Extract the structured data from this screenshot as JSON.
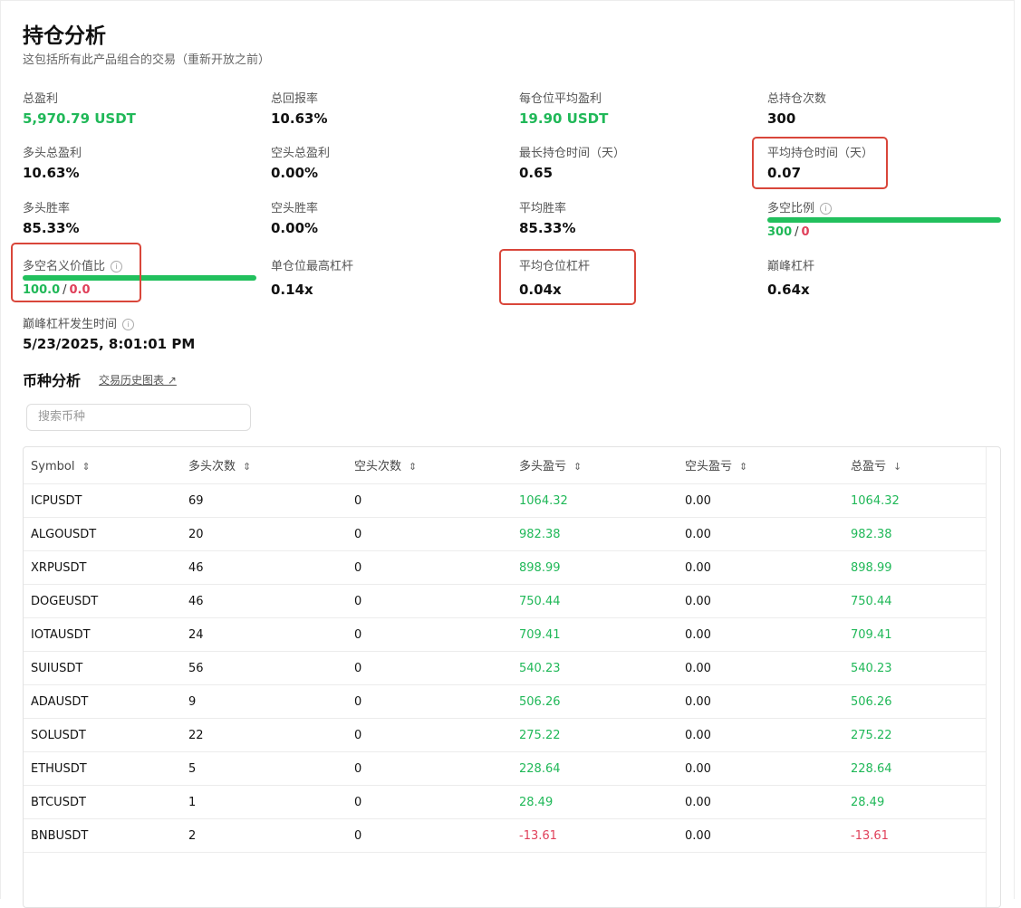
{
  "header": {
    "title": "持仓分析",
    "subtitle": "这包括所有此产品组合的交易（重新开放之前）"
  },
  "metrics": [
    {
      "label": "总盈利",
      "value": "5,970.79 USDT",
      "tone": "green"
    },
    {
      "label": "总回报率",
      "value": "10.63%"
    },
    {
      "label": "每仓位平均盈利",
      "value": "19.90 USDT",
      "tone": "green"
    },
    {
      "label": "总持仓次数",
      "value": "300"
    },
    {
      "label": "多头总盈利",
      "value": "10.63%"
    },
    {
      "label": "空头总盈利",
      "value": "0.00%"
    },
    {
      "label": "最长持仓时间（天）",
      "value": "0.65"
    },
    {
      "label": "平均持仓时间（天）",
      "value": "0.07"
    },
    {
      "label": "多头胜率",
      "value": "85.33%"
    },
    {
      "label": "空头胜率",
      "value": "0.00%"
    },
    {
      "label": "平均胜率",
      "value": "85.33%"
    },
    {
      "label": "多空比例",
      "long": "300",
      "short": "0",
      "long_share": 1.0
    },
    {
      "label": "多空名义价值比",
      "long": "100.0",
      "short": "0.0",
      "long_share": 1.0
    },
    {
      "label": "单仓位最高杠杆",
      "value": "0.14x"
    },
    {
      "label": "平均仓位杠杆",
      "value": "0.04x"
    },
    {
      "label": "巅峰杠杆",
      "value": "0.64x"
    },
    {
      "label": "巅峰杠杆发生时间",
      "value": "5/23/2025, 8:01:01 PM"
    }
  ],
  "coin_section": {
    "title": "币种分析",
    "history_link": "交易历史图表 ↗",
    "search_placeholder": "搜索币种"
  },
  "table": {
    "columns": [
      "Symbol",
      "多头次数",
      "空头次数",
      "多头盈亏",
      "空头盈亏",
      "总盈亏"
    ],
    "sort_icons": [
      "⇕",
      "⇕",
      "⇕",
      "⇕",
      "⇕",
      "↓"
    ],
    "rows": [
      [
        "ICPUSDT",
        "69",
        "0",
        "1064.32",
        "0.00",
        "1064.32"
      ],
      [
        "ALGOUSDT",
        "20",
        "0",
        "982.38",
        "0.00",
        "982.38"
      ],
      [
        "XRPUSDT",
        "46",
        "0",
        "898.99",
        "0.00",
        "898.99"
      ],
      [
        "DOGEUSDT",
        "46",
        "0",
        "750.44",
        "0.00",
        "750.44"
      ],
      [
        "IOTAUSDT",
        "24",
        "0",
        "709.41",
        "0.00",
        "709.41"
      ],
      [
        "SUIUSDT",
        "56",
        "0",
        "540.23",
        "0.00",
        "540.23"
      ],
      [
        "ADAUSDT",
        "9",
        "0",
        "506.26",
        "0.00",
        "506.26"
      ],
      [
        "SOLUSDT",
        "22",
        "0",
        "275.22",
        "0.00",
        "275.22"
      ],
      [
        "ETHUSDT",
        "5",
        "0",
        "228.64",
        "0.00",
        "228.64"
      ],
      [
        "BTCUSDT",
        "1",
        "0",
        "28.49",
        "0.00",
        "28.49"
      ],
      [
        "BNBUSDT",
        "2",
        "0",
        "-13.61",
        "0.00",
        "-13.61"
      ]
    ]
  },
  "colors": {
    "positive": "#20b858",
    "negative": "#e0405a",
    "highlight": "#d9463a"
  }
}
